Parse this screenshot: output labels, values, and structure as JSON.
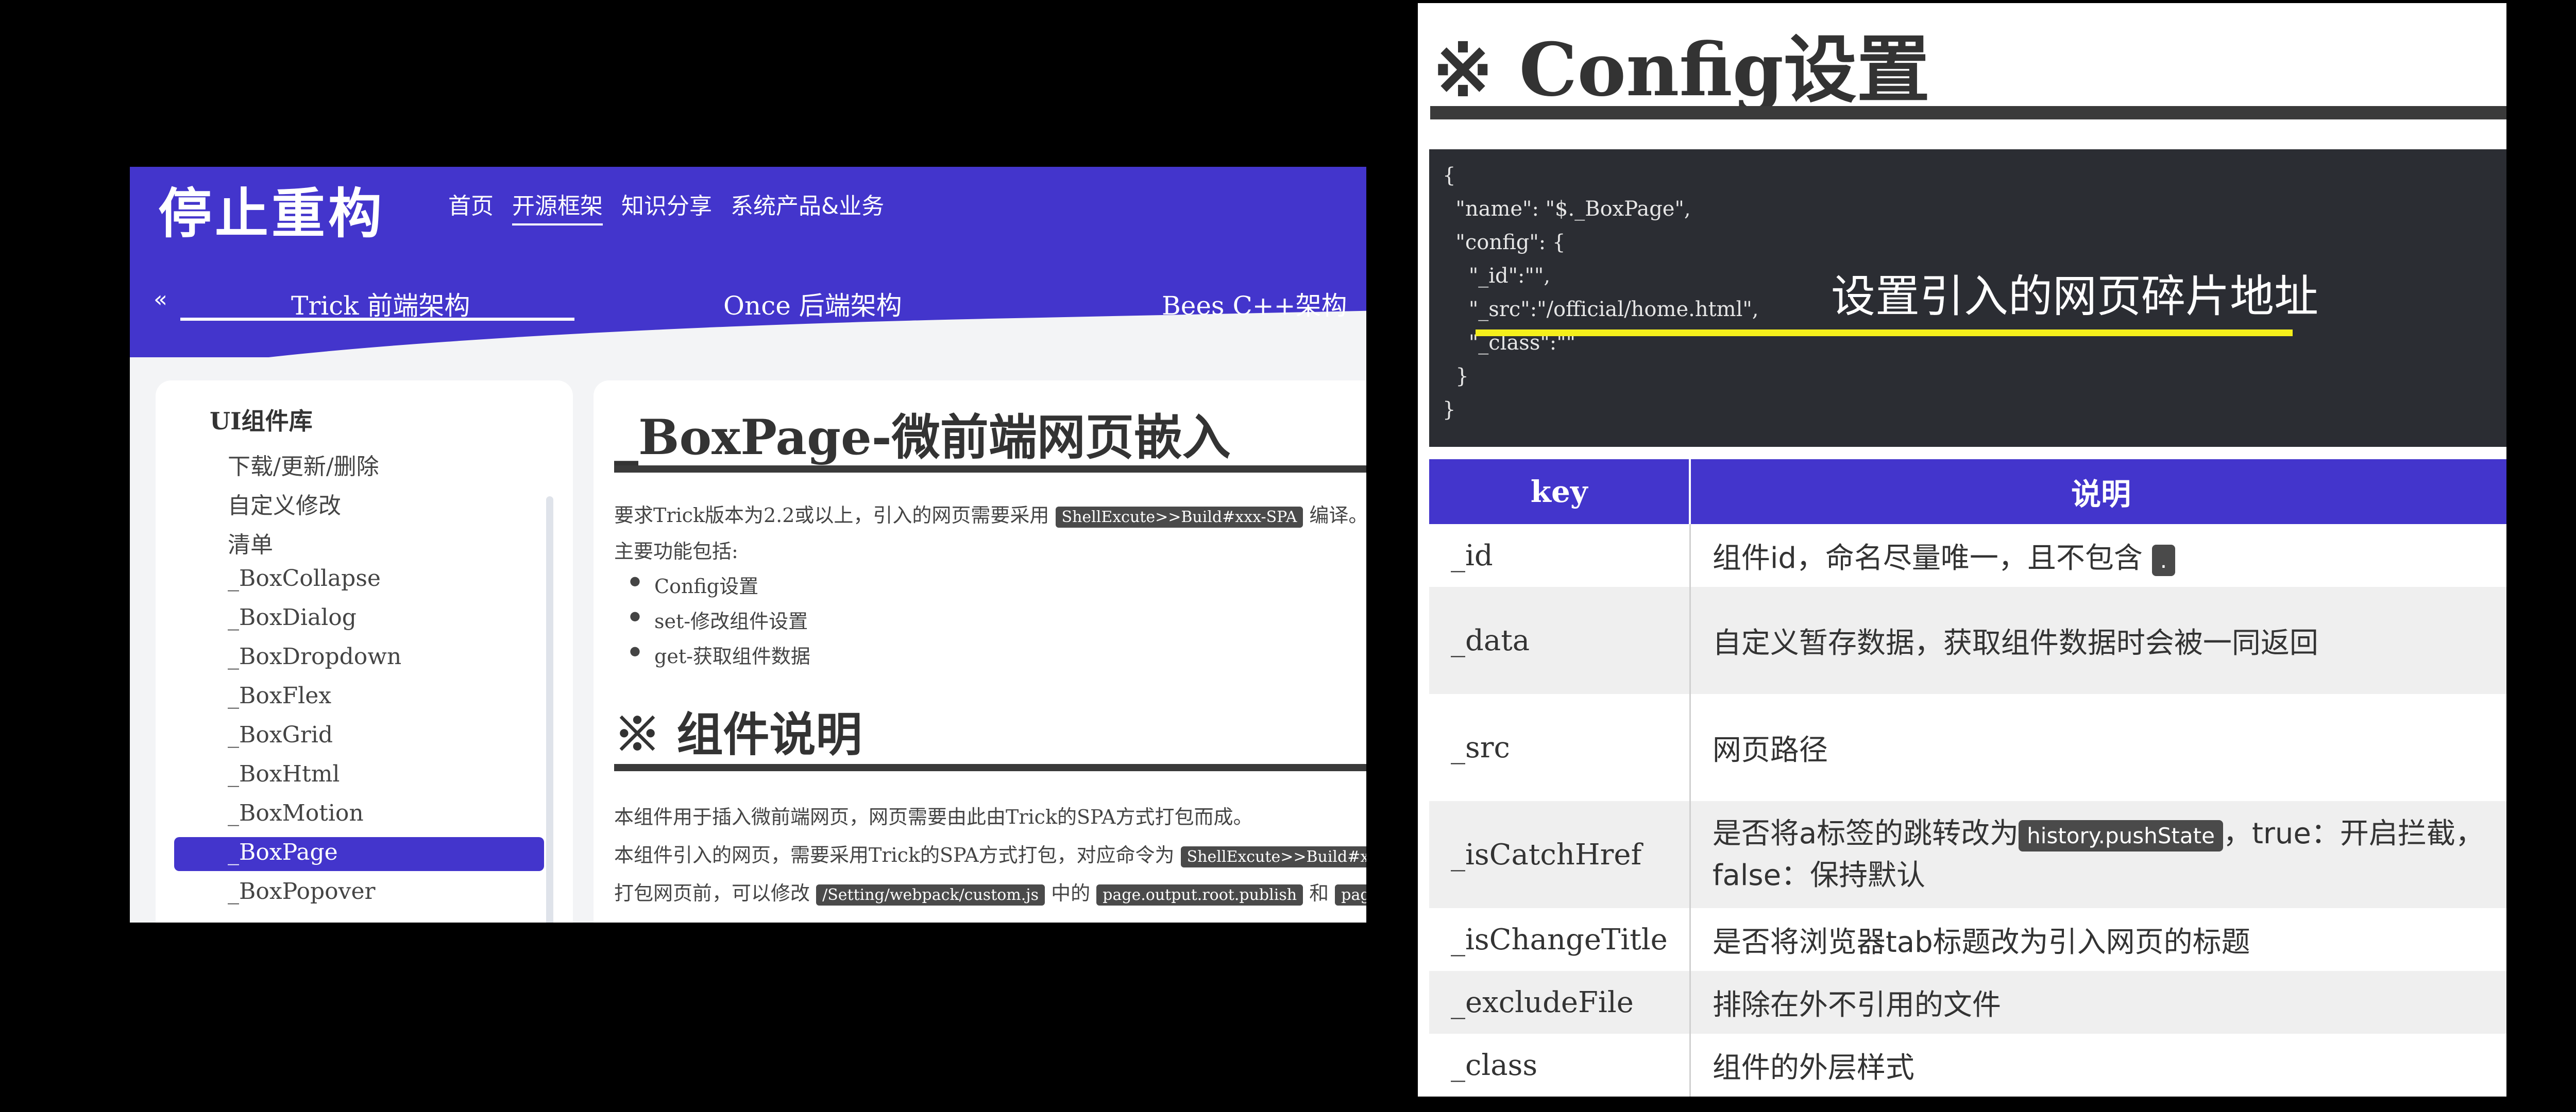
{
  "left": {
    "logo": "停止重构",
    "nav": [
      "首页",
      "开源框架",
      "知识分享",
      "系统产品&业务"
    ],
    "sub_prev": "«",
    "sub_tabs": [
      "Trick 前端架构",
      "Once 后端架构",
      "Bees C++架构"
    ],
    "sidebar": {
      "title": "UI组件库",
      "items": [
        "下载/更新/删除",
        "自定义修改",
        "清单",
        "_BoxCollapse",
        "_BoxDialog",
        "_BoxDropdown",
        "_BoxFlex",
        "_BoxGrid",
        "_BoxHtml",
        "_BoxMotion",
        "_BoxPage",
        "_BoxPopover"
      ],
      "active": "_BoxPage"
    },
    "content": {
      "h1": "_BoxPage-微前端网页嵌入",
      "p1_a": "要求Trick版本为2.2或以上，引入的网页需要采用",
      "p1_chip": "ShellExcute>>Build#xxx-SPA",
      "p1_b": "编译。",
      "p2": "主要功能包括:",
      "bullets": [
        "Config设置",
        "set-修改组件设置",
        "get-获取组件数据"
      ],
      "h2": "※ 组件说明",
      "p3": "本组件用于插入微前端网页，网页需要由此由Trick的SPA方式打包而成。",
      "p4_a": "本组件引入的网页，需要采用Trick的SPA方式打包，对应命令为",
      "p4_chip": "ShellExcute>>Build#xxx",
      "p5_a": "打包网页前，可以修改",
      "p5_chip1": "/Setting/webpack/custom.js",
      "p5_b": "中的",
      "p5_chip2": "page.output.root.publish",
      "p5_c": "和",
      "p5_chip3": "page.outpu"
    }
  },
  "right": {
    "title": "※ Config设置",
    "code_lines": [
      "{",
      "  \"name\": \"$._BoxPage\",",
      "  \"config\": {",
      "    \"_id\":\"\",",
      "    \"_src\":\"/official/home.html\",",
      "    \"_class\":\"\"",
      "  }",
      "}"
    ],
    "callout": "设置引入的网页碎片地址",
    "table": {
      "headers": [
        "key",
        "说明"
      ],
      "rows": [
        {
          "key": "_id",
          "desc": "组件id，命名尽量唯一，且不包含",
          "chip": "."
        },
        {
          "key": "_data",
          "desc": "自定义暂存数据，获取组件数据时会被一同返回"
        },
        {
          "key": "_src",
          "desc": "网页路径"
        },
        {
          "key": "_isCatchHref",
          "desc_a": "是否将a标签的跳转改为",
          "chip": "history.pushState",
          "desc_b": "，true：开启拦截，",
          "desc_c": "false：保持默认"
        },
        {
          "key": "_isChangeTitle",
          "desc": "是否将浏览器tab标题改为引入网页的标题"
        },
        {
          "key": "_excludeFile",
          "desc": "排除在外不引用的文件"
        },
        {
          "key": "_class",
          "desc": "组件的外层样式"
        }
      ]
    }
  },
  "colors": {
    "accent": "#4335cc",
    "code_bg": "#2b2d33",
    "highlight": "#f5ef1b"
  }
}
